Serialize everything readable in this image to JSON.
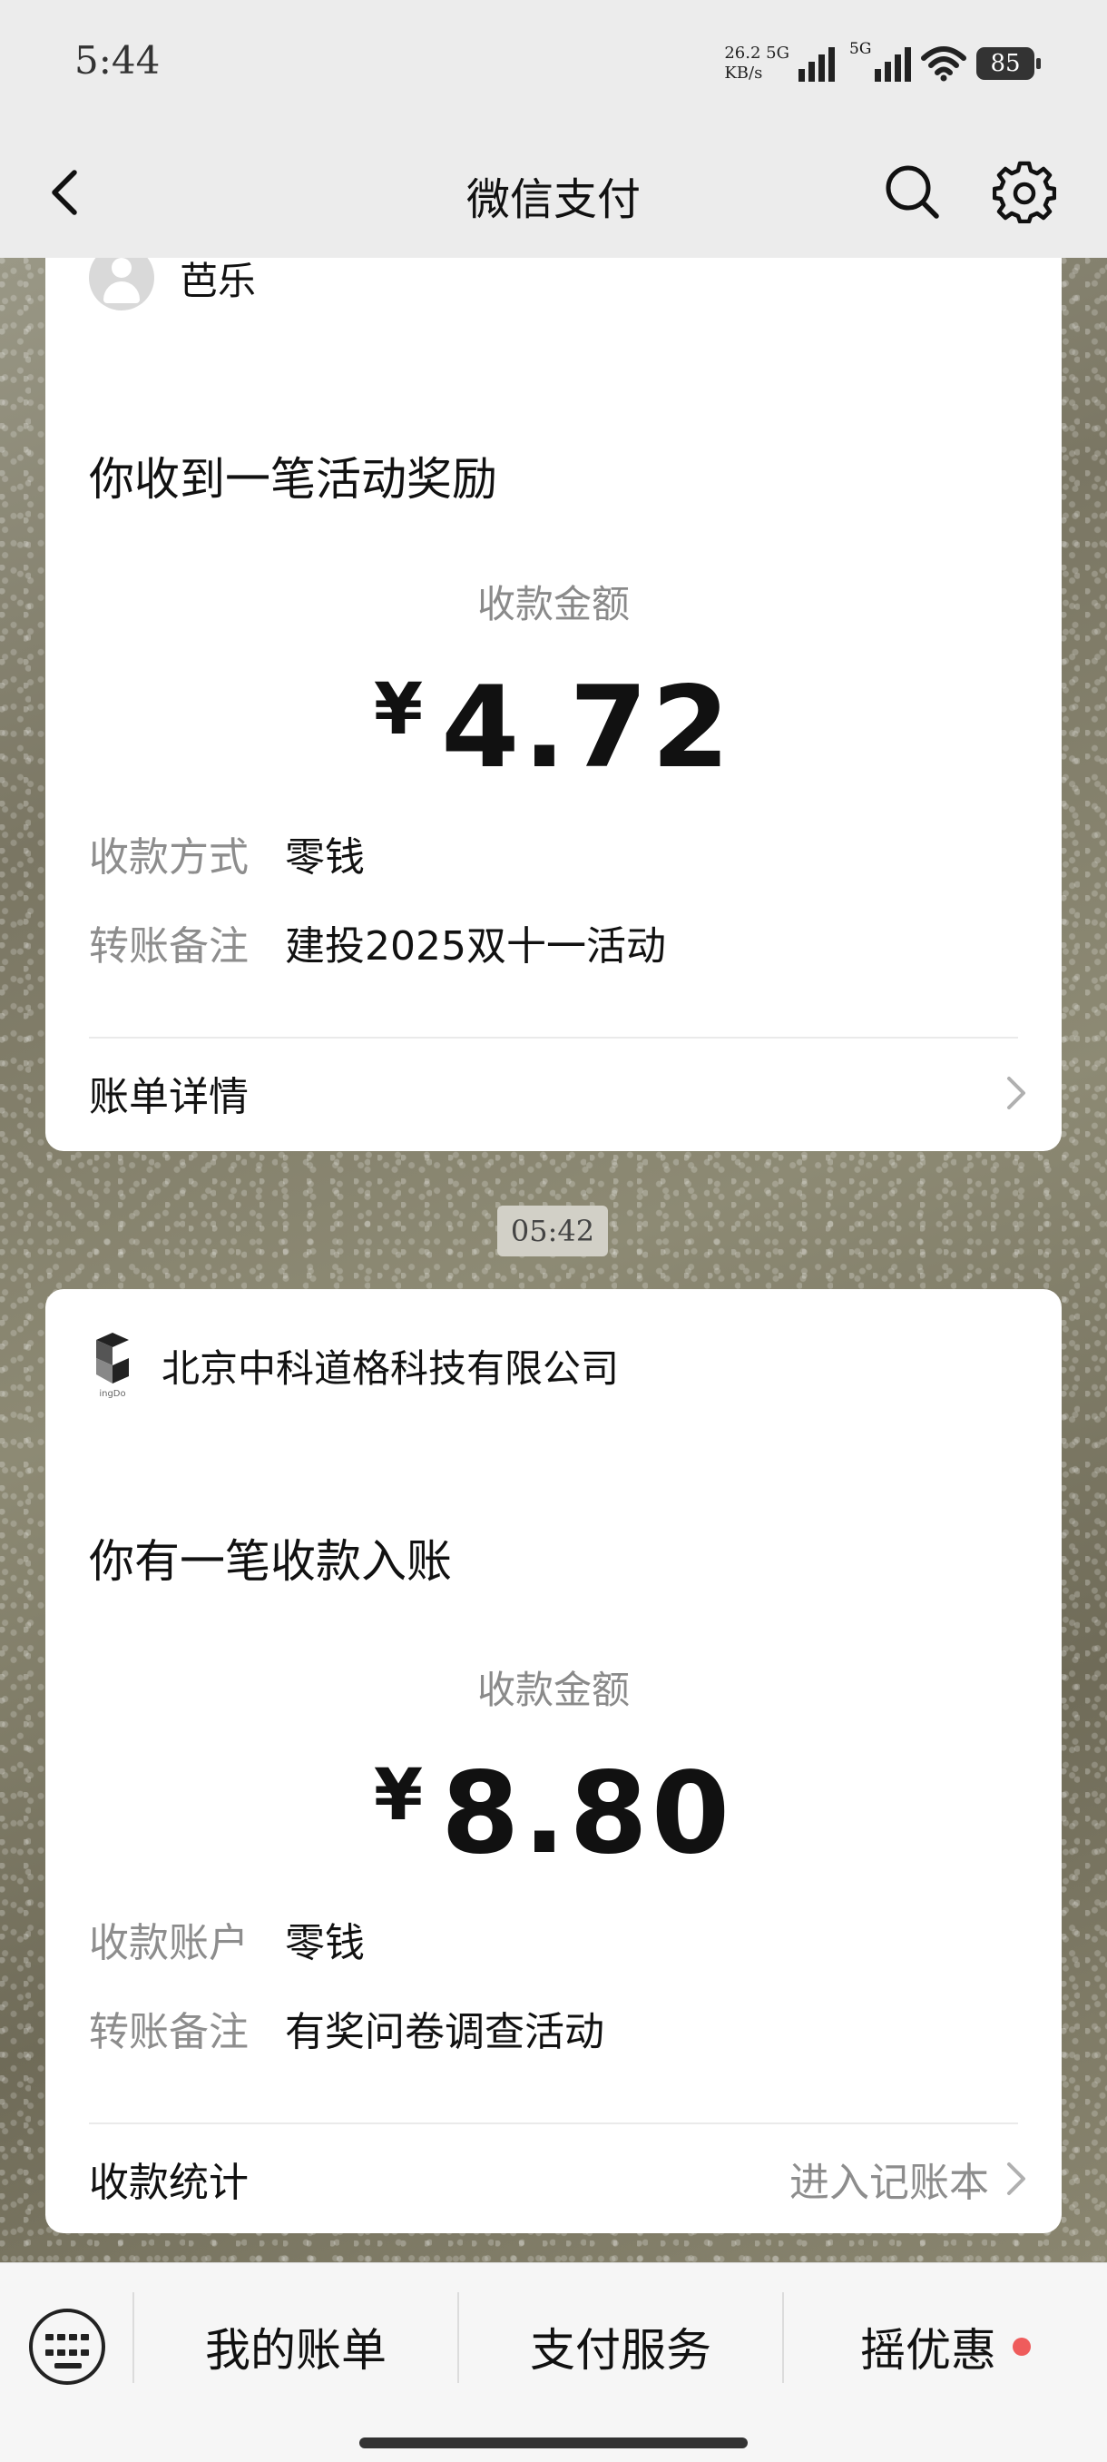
{
  "status_bar": {
    "time": "5:44",
    "net_speed_value": "26.2",
    "net_speed_unit": "KB/s",
    "network_1": "5G",
    "network_2": "5G",
    "battery": "85"
  },
  "header": {
    "title": "微信支付"
  },
  "messages": [
    {
      "sender": "芭乐",
      "headline": "你收到一笔活动奖励",
      "amount_label": "收款金额",
      "currency": "¥",
      "amount": "4.72",
      "rows": [
        {
          "key": "收款方式",
          "value": "零钱"
        },
        {
          "key": "转账备注",
          "value": "建投2025双十一活动"
        }
      ],
      "footer_label": "账单详情",
      "footer_action": ""
    },
    {
      "sender": "北京中科道格科技有限公司",
      "headline": "你有一笔收款入账",
      "amount_label": "收款金额",
      "currency": "¥",
      "amount": "8.80",
      "rows": [
        {
          "key": "收款账户",
          "value": "零钱"
        },
        {
          "key": "转账备注",
          "value": "有奖问卷调查活动"
        }
      ],
      "footer_label": "收款统计",
      "footer_action": "进入记账本"
    }
  ],
  "time_divider": "05:42",
  "bottom_menu": {
    "items": [
      "我的账单",
      "支付服务",
      "摇优惠"
    ],
    "badge_color": "#ef5c5c"
  },
  "colors": {
    "nav_bg": "#ececec",
    "card_bg": "#ffffff",
    "muted_text": "#8d8d8d"
  }
}
